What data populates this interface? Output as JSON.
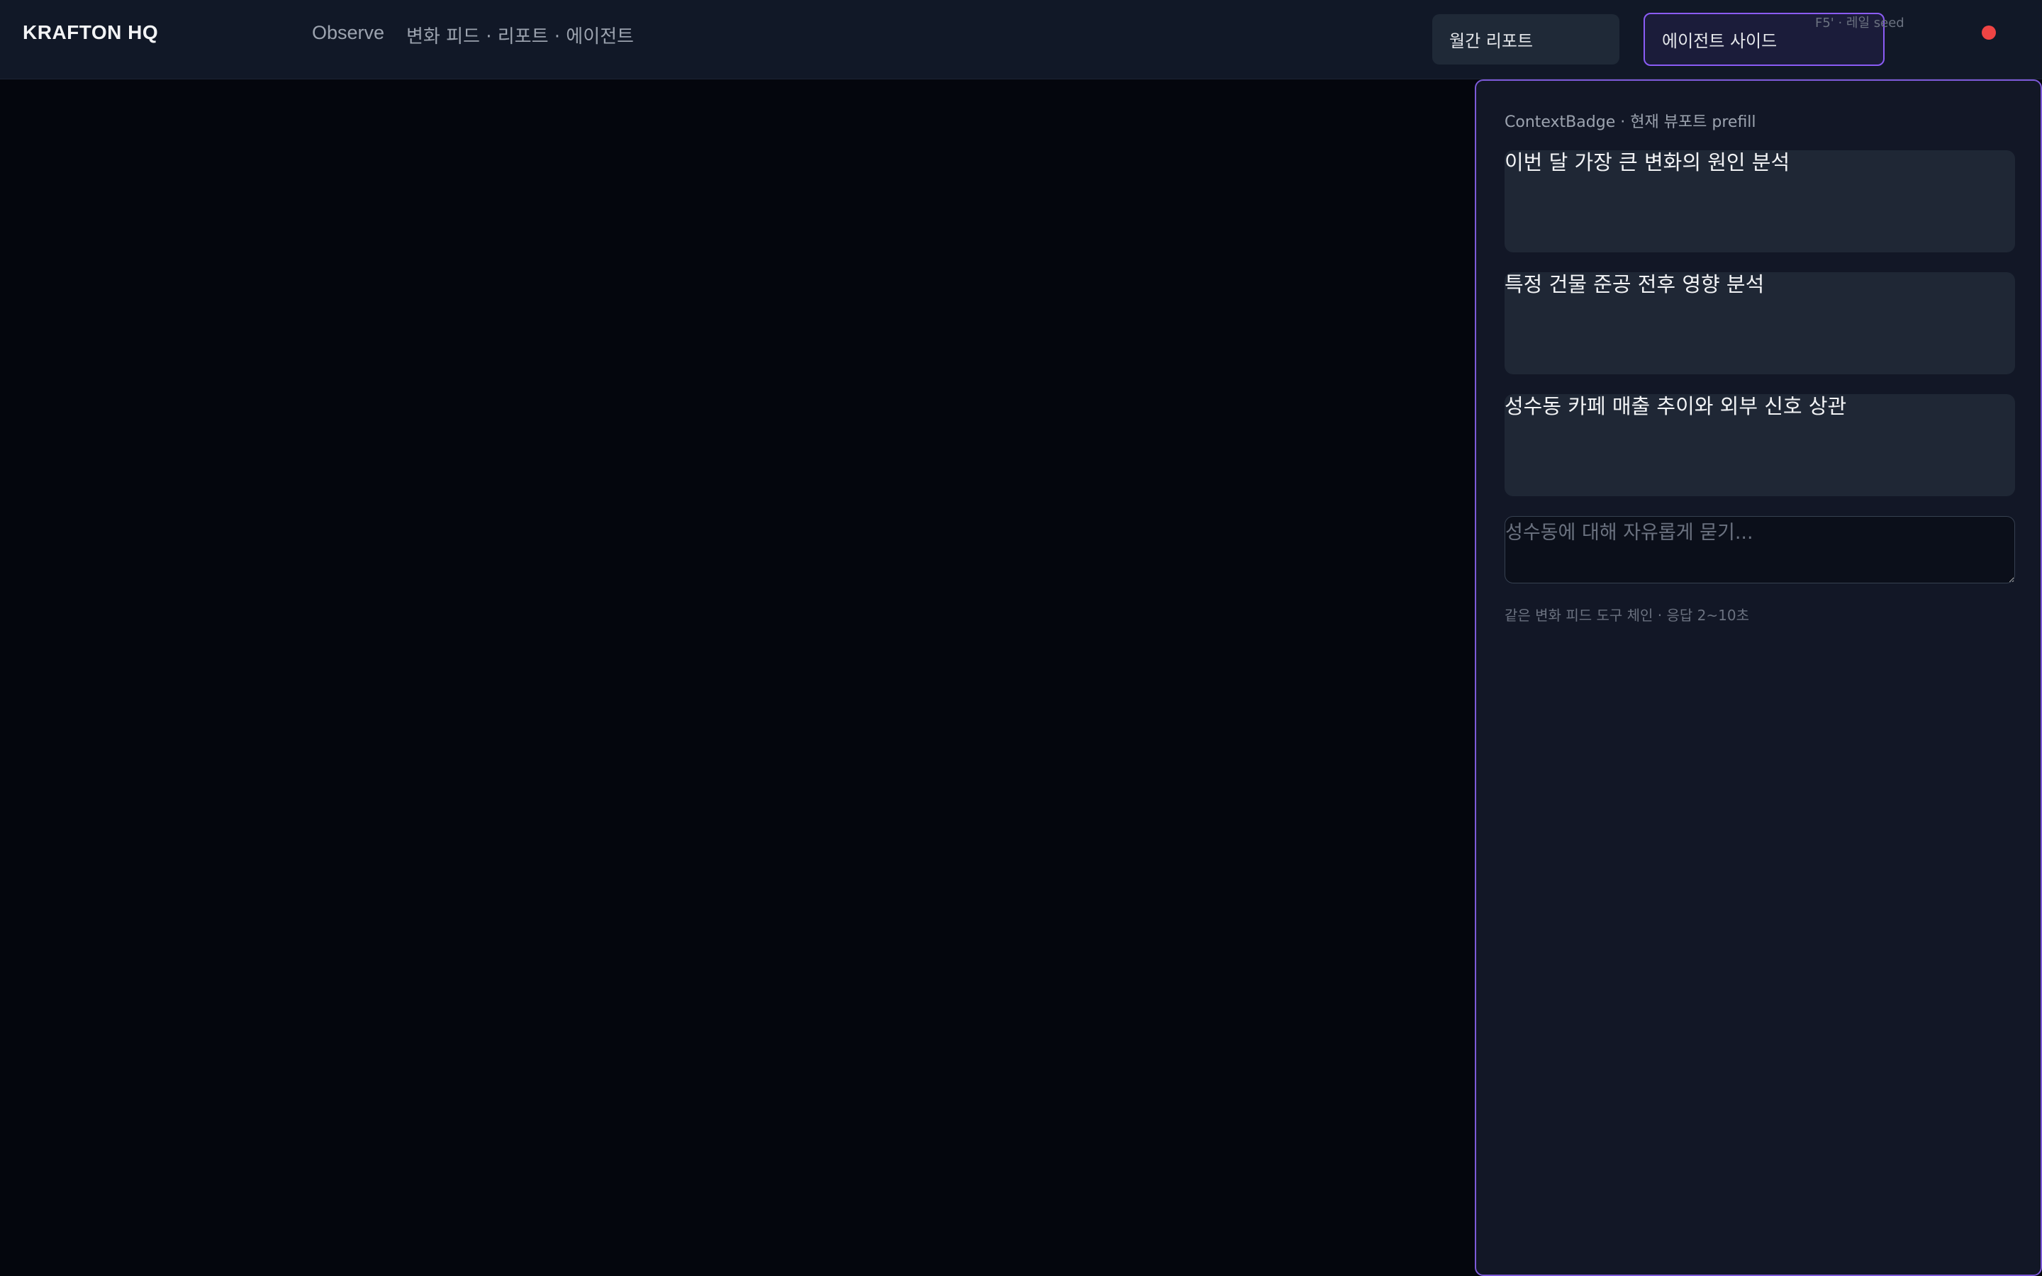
{
  "app": {
    "logo": "KRAFTON HQ",
    "nav_title": "Observe",
    "nav_subtitle": "변화 피드 · 리포트 · 에이전트"
  },
  "header": {
    "report_button": "월간 리포트",
    "agent_button": "에이전트 사이드",
    "seed_note": "F5' · 레일 seed",
    "status_color": "#ef4444"
  },
  "agent_panel": {
    "context_badge": "ContextBadge · 현재 뷰포트 prefill",
    "prompts": [
      "이번 달 가장 큰 변화의 원인 분석",
      "특정 건물 준공 전후 영향 분석",
      "성수동 카페 매출 추이와 외부 신호 상관"
    ],
    "input_placeholder": "성수동에 대해 자유롭게 묻기...",
    "footer_note": "같은 변화 피드 도구 체인 · 응답 2~10초"
  },
  "colors": {
    "accent": "#8b5cf6",
    "background": "#04060d",
    "surface": "#111827"
  }
}
